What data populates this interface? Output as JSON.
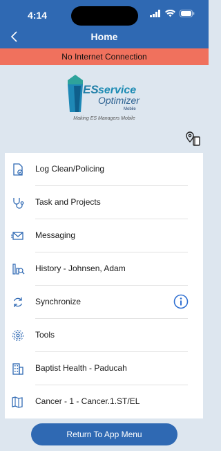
{
  "status_bar": {
    "time": "4:14"
  },
  "header": {
    "title": "Home"
  },
  "banner": {
    "text": "No Internet Connection"
  },
  "logo": {
    "es": "ES",
    "service": "service",
    "optimizer": "Optimizer",
    "mobile": "Mobile",
    "tagline": "Making ES Managers Mobile"
  },
  "menu": {
    "items": [
      {
        "label": "Log Clean/Policing",
        "icon": "document-check-icon"
      },
      {
        "label": "Task and Projects",
        "icon": "stethoscope-icon"
      },
      {
        "label": "Messaging",
        "icon": "envelope-icon"
      },
      {
        "label": "History - Johnsen, Adam",
        "icon": "history-chart-icon"
      },
      {
        "label": "Synchronize",
        "icon": "sync-icon"
      },
      {
        "label": "Tools",
        "icon": "gear-icon"
      },
      {
        "label": "Baptist Health - Paducah",
        "icon": "building-icon"
      },
      {
        "label": "Cancer - 1 - Cancer.1.ST/EL",
        "icon": "map-book-icon"
      }
    ]
  },
  "cta": {
    "label": "Return To App Menu"
  },
  "colors": {
    "header": "#2f69b3",
    "banner": "#f0715d",
    "background": "#dde6ef",
    "accent": "#2f69b3"
  }
}
